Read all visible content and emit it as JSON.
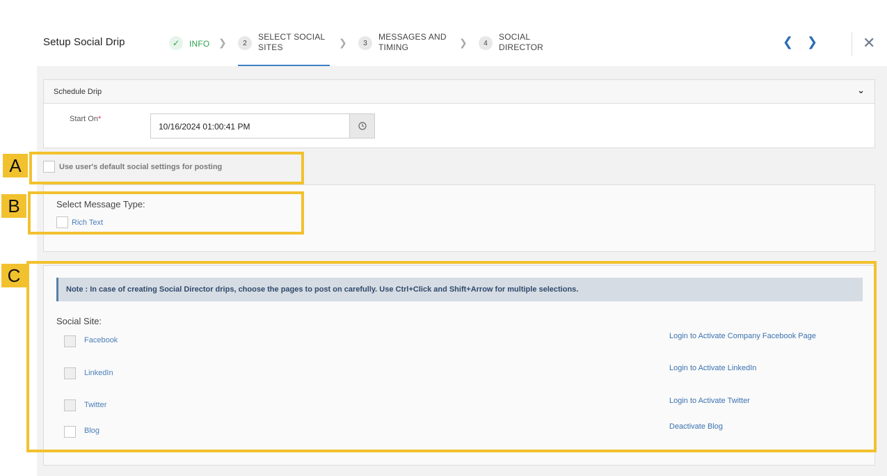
{
  "header": {
    "title": "Setup Social Drip",
    "steps": [
      {
        "num": "",
        "label": "INFO",
        "state": "done"
      },
      {
        "num": "2",
        "label_line1": "SELECT SOCIAL",
        "label_line2": "SITES",
        "state": "active"
      },
      {
        "num": "3",
        "label_line1": "MESSAGES AND",
        "label_line2": "TIMING",
        "state": "pending"
      },
      {
        "num": "4",
        "label_line1": "SOCIAL",
        "label_line2": "DIRECTOR",
        "state": "pending"
      }
    ]
  },
  "schedule": {
    "title": "Schedule Drip",
    "start_label": "Start On",
    "required_mark": "*",
    "start_value": "10/16/2024 01:00:41 PM"
  },
  "default_settings": {
    "label": "Use user's default social settings for posting"
  },
  "message_type": {
    "label": "Select Message Type:",
    "option": "Rich Text"
  },
  "social": {
    "note": "Note : In case of creating Social Director drips, choose the pages to post on carefully. Use Ctrl+Click and Shift+Arrow for multiple selections.",
    "label": "Social Site:",
    "sites": [
      {
        "name": "Facebook",
        "action": "Login to Activate Company Facebook Page"
      },
      {
        "name": "LinkedIn",
        "action": "Login to Activate LinkedIn"
      },
      {
        "name": "Twitter",
        "action": "Login to Activate Twitter"
      },
      {
        "name": "Blog",
        "action": "Deactivate Blog"
      }
    ]
  },
  "annotations": {
    "a": "A",
    "b": "B",
    "c": "C"
  },
  "colors": {
    "accent": "#3b7fc4",
    "done": "#2e9e4f",
    "annotation": "#f2c12e"
  }
}
